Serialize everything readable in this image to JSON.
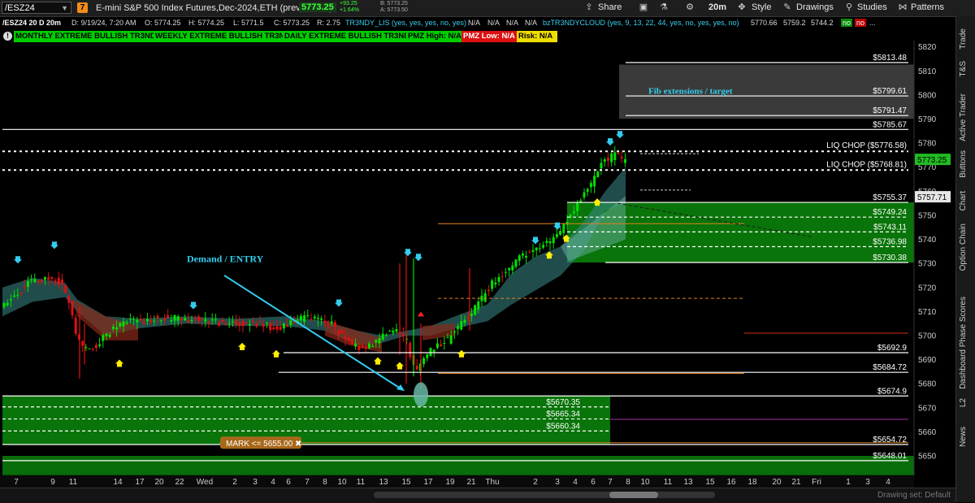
{
  "toolbar": {
    "symbol": "/ESZ24",
    "link_badge": "7",
    "title": "E-mini S&P 500 Index Futures,Dec-2024,ETH (prev. /ESZ4)",
    "last_price": "5773.25",
    "change_abs": "+93.25",
    "change_pct": "+1.64%",
    "bid": "B: 5773.25",
    "ask": "A: 5773.50",
    "share_label": "Share",
    "timeframe": "20m",
    "style_label": "Style",
    "drawings_label": "Drawings",
    "studies_label": "Studies",
    "patterns_label": "Patterns"
  },
  "info": {
    "chart_id": "/ESZ24 20 D 20m",
    "date": "D: 9/19/24, 7:20 AM",
    "open": "O: 5774.25",
    "high": "H: 5774.25",
    "low": "L: 5771.5",
    "close": "C: 5773.25",
    "range": "R: 2.75",
    "study1": "TR3NDY_LIS (yes, yes, yes, no, yes)",
    "na1": "N/A",
    "na2": "N/A",
    "na3": "N/A",
    "na4": "N/A",
    "study2": "bzTR3NDYCLOUD (yes, 9, 13, 22, 44, yes, no, yes, yes, no)",
    "v1": "5770.66",
    "v2": "5759.2",
    "v3": "5744.2",
    "no1": "no",
    "no2": "no",
    "more": "..."
  },
  "labels": {
    "monthly": "MONTHLY EXTREME BULLISH TR3ND",
    "weekly": "WEEKLY EXTREME BULLISH TR3ND",
    "daily": "DAILY EXTREME BULLISH TR3ND",
    "pmz_high": "PMZ High: N/A",
    "pmz_low": "PMZ Low: N/A",
    "risk": "Risk: N/A"
  },
  "annotations": {
    "demand": "Demand / ENTRY",
    "fib": "Fib extensions / target",
    "liq1": "LIQ CHOP ($5776.58)",
    "liq2": "LIQ CHOP ($5768.81)",
    "mark": "MARK <= 5655.00"
  },
  "levels": [
    {
      "label": "$5813.48",
      "value": 5813.48
    },
    {
      "label": "$5799.61",
      "value": 5799.61
    },
    {
      "label": "$5791.47",
      "value": 5791.47
    },
    {
      "label": "$5785.67",
      "value": 5785.67
    },
    {
      "label": "$5755.37",
      "value": 5755.37
    },
    {
      "label": "$5749.24",
      "value": 5749.24
    },
    {
      "label": "$5743.11",
      "value": 5743.11
    },
    {
      "label": "$5736.98",
      "value": 5736.98
    },
    {
      "label": "$5730.38",
      "value": 5730.38
    },
    {
      "label": "$5692.9",
      "value": 5692.9
    },
    {
      "label": "$5684.72",
      "value": 5684.72
    },
    {
      "label": "$5674.9",
      "value": 5674.9
    },
    {
      "label": "$5670.35",
      "value": 5670.35
    },
    {
      "label": "$5665.34",
      "value": 5665.34
    },
    {
      "label": "$5660.34",
      "value": 5660.34
    },
    {
      "label": "$5654.72",
      "value": 5654.72
    },
    {
      "label": "$5648.01",
      "value": 5648.01
    }
  ],
  "axis": {
    "y_ticks": [
      5820,
      5810,
      5800,
      5790,
      5780,
      5770,
      5760,
      5750,
      5740,
      5730,
      5720,
      5710,
      5700,
      5690,
      5680,
      5670,
      5660,
      5650
    ],
    "y_range": [
      5642,
      5824
    ],
    "price_badge": "5773.25",
    "price_badge2": "5757.71",
    "x_ticks": [
      "7",
      "9",
      "11",
      "14",
      "17",
      "20",
      "22",
      "Wed",
      "2",
      "3",
      "4",
      "6",
      "7",
      "8",
      "10",
      "11",
      "13",
      "15",
      "17",
      "19",
      "21",
      "Thu",
      "2",
      "3",
      "4",
      "6",
      "7",
      "8",
      "10",
      "11",
      "13",
      "15",
      "16",
      "18",
      "20",
      "21",
      "Fri",
      "1",
      "3",
      "4"
    ]
  },
  "side_tabs": [
    "Trade",
    "T&S",
    "Active Trader",
    "Buttons",
    "Chart",
    "Option Chain",
    "Phase Scores",
    "Dashboard",
    "L2",
    "News"
  ],
  "footer": {
    "drawing_set": "Drawing set: Default"
  },
  "colors": {
    "bull": "#00e000",
    "bear": "#e01010",
    "zone": "#0a7a0a",
    "cloud": "#3a8a8a",
    "accent": "#33ccee"
  }
}
